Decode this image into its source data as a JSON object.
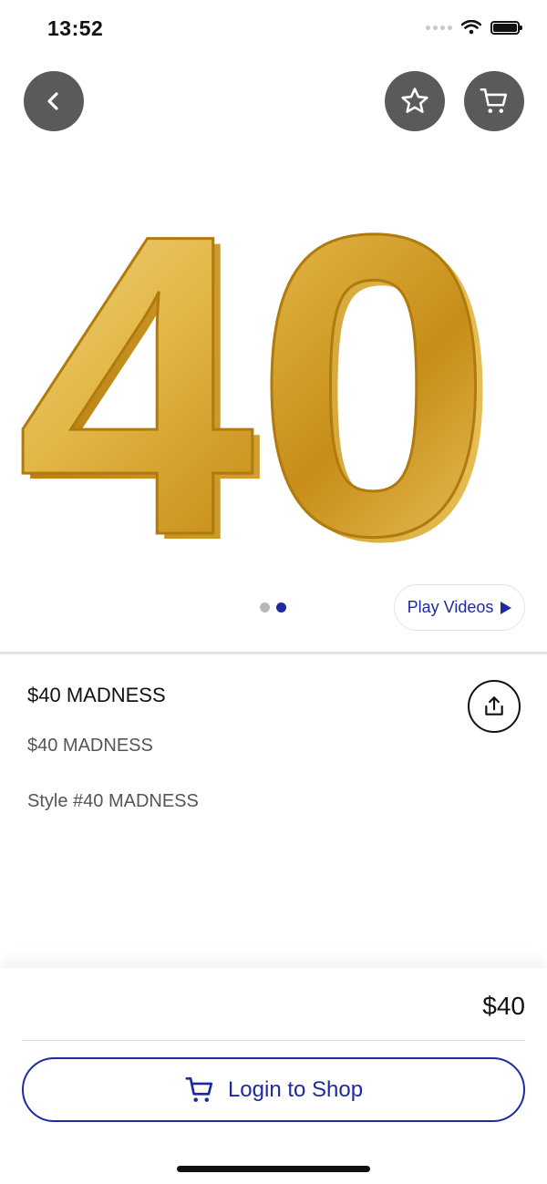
{
  "status_bar": {
    "time": "13:52"
  },
  "header": {
    "back_icon": "chevron-left-icon",
    "favorite_icon": "star-icon",
    "cart_icon": "cart-icon"
  },
  "hero": {
    "image_text": "40",
    "image_color": "#d9a733",
    "pager": {
      "count": 2,
      "active_index": 1
    }
  },
  "play_videos_label": "Play Videos",
  "product": {
    "title": "$40 MADNESS",
    "subtitle": "$40 MADNESS",
    "style": "Style #40 MADNESS"
  },
  "bottom": {
    "price": "$40",
    "login_label": "Login to Shop"
  },
  "colors": {
    "accent": "#1d2aa0",
    "button_bg": "#5a5a5a",
    "gold": "#d9a733"
  }
}
